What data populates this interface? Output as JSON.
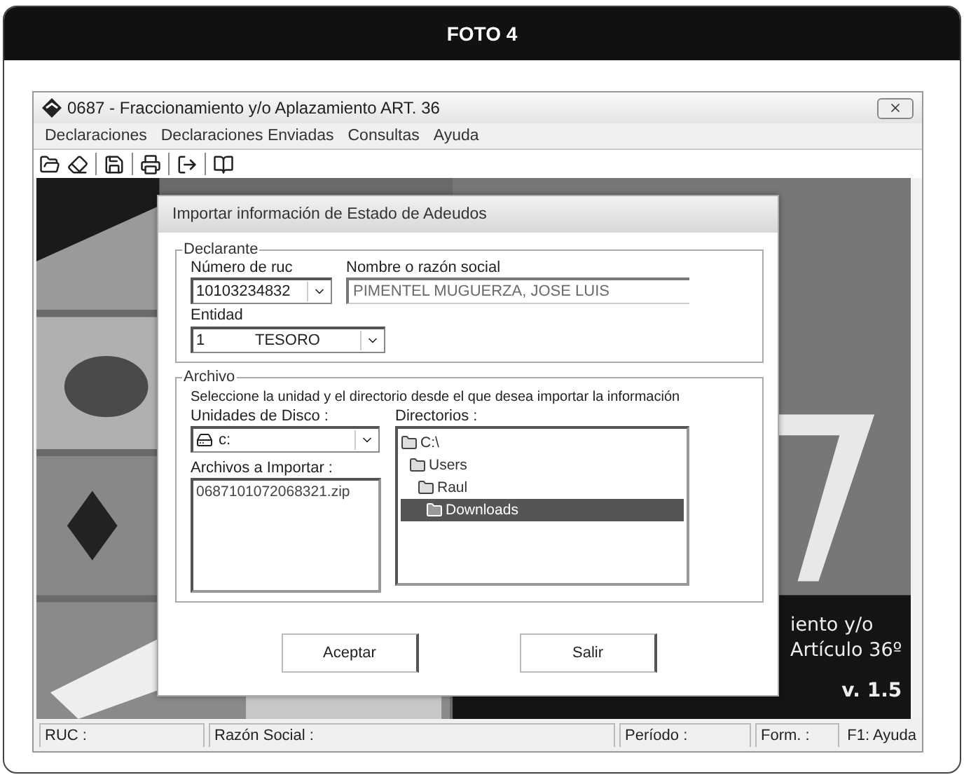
{
  "header": {
    "title": "FOTO 4"
  },
  "window": {
    "title": "0687 - Fraccionamiento y/o Aplazamiento ART. 36"
  },
  "menu": [
    "Declaraciones",
    "Declaraciones Enviadas",
    "Consultas",
    "Ayuda"
  ],
  "splash": {
    "lines": [
      "iento y/o",
      "Artículo 36º"
    ],
    "version": "v. 1.5"
  },
  "dialog": {
    "title": "Importar información de Estado de Adeudos",
    "declarante": {
      "legend": "Declarante",
      "ruc": {
        "label": "Número de ruc",
        "value": "10103234832"
      },
      "name": {
        "label": "Nombre o razón social",
        "value": "PIMENTEL MUGUERZA, JOSE LUIS",
        "disabled": true
      },
      "entidad": {
        "label": "Entidad",
        "code": "1",
        "value": "TESORO"
      }
    },
    "archivo": {
      "legend": "Archivo",
      "instruction": "Seleccione la unidad y el directorio desde el que desea importar la información",
      "drives": {
        "label": "Unidades de Disco :",
        "value": "c:"
      },
      "files": {
        "label": "Archivos a Importar :",
        "items": [
          {
            "name": "0687101072068321.zip",
            "selected": false
          }
        ]
      },
      "directories": {
        "label": "Directorios :",
        "tree": [
          {
            "name": "C:\\",
            "selected": false,
            "children": [
              {
                "name": "Users",
                "selected": false,
                "children": [
                  {
                    "name": "Raul",
                    "selected": false,
                    "children": [
                      {
                        "name": "Downloads",
                        "selected": true
                      }
                    ]
                  }
                ]
              }
            ]
          }
        ]
      }
    },
    "buttons": [
      "Aceptar",
      "Salir"
    ]
  },
  "status_bar": [
    "RUC :",
    "Razón Social :",
    "Período :",
    "Form. :",
    "F1: Ayuda"
  ]
}
